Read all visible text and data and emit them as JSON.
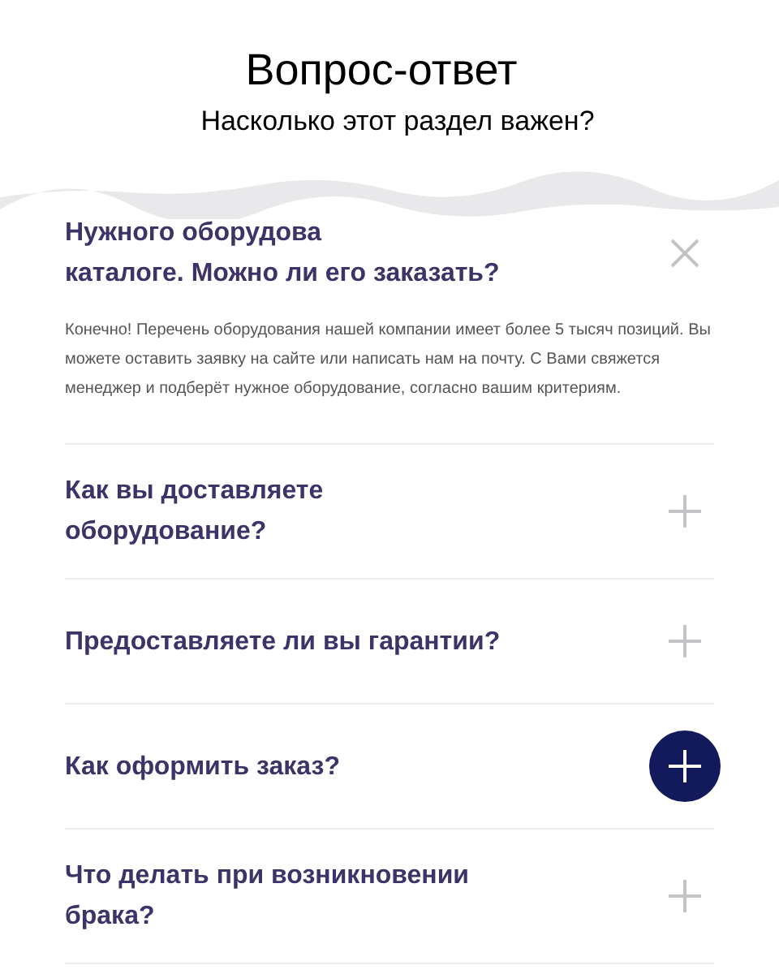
{
  "title": "Вопрос-ответ",
  "subtitle": "Насколько этот раздел важен?",
  "faq": [
    {
      "question_lines": [
        "Нужного оборудова",
        "каталоге. Можно ли его заказать?"
      ],
      "answer": "Конечно! Перечень оборудования нашей компании имеет более 5 тысяч позиций. Вы можете оставить заявку на сайте или написать нам на почту. С Вами свяжется менеджер и подберёт нужное оборудование, согласно вашим критериям.",
      "expanded": true,
      "highlighted": false
    },
    {
      "question_lines": [
        "Как вы доставляете",
        "оборудование?"
      ],
      "expanded": false,
      "highlighted": false
    },
    {
      "question_lines": [
        "Предоставляете ли вы гарантии?"
      ],
      "expanded": false,
      "highlighted": false
    },
    {
      "question_lines": [
        "Как оформить заказ?"
      ],
      "expanded": false,
      "highlighted": true
    },
    {
      "question_lines": [
        "Что делать при возникновении",
        "брака?"
      ],
      "expanded": false,
      "highlighted": false
    }
  ]
}
